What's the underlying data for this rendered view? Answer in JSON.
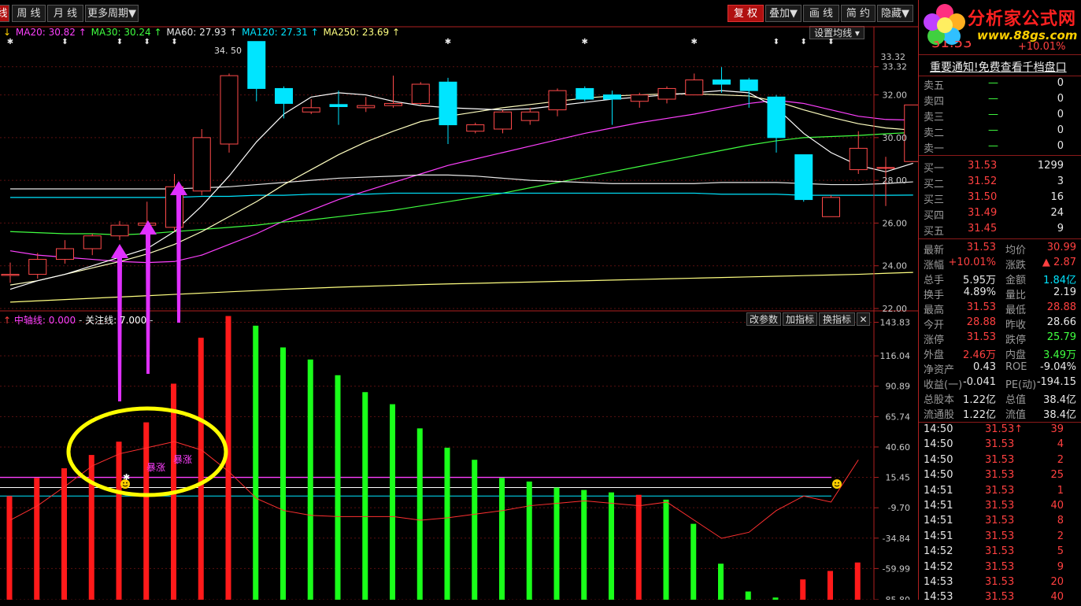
{
  "toolbar": {
    "left_partial": "线",
    "tabs": [
      {
        "label": "周 线"
      },
      {
        "label": "月 线"
      },
      {
        "label": "更多周期▼"
      }
    ],
    "right_buttons": [
      {
        "label": "复 权",
        "active": true
      },
      {
        "label": "叠加▼",
        "active": false
      },
      {
        "label": "画 线",
        "active": false
      },
      {
        "label": "简 约",
        "active": false
      },
      {
        "label": "隐藏▼",
        "active": false
      }
    ]
  },
  "main_legend": [
    {
      "text": "↓",
      "color": "#ffd000"
    },
    {
      "text": "MA20: 30.82 ↑",
      "color": "#ff40ff"
    },
    {
      "text": "MA30: 30.24 ↑",
      "color": "#40ff40"
    },
    {
      "text": "MA60: 27.93 ↑",
      "color": "#e8e8e8"
    },
    {
      "text": "MA120: 27.31 ↑",
      "color": "#00e5ff"
    },
    {
      "text": "MA250: 23.69 ↑",
      "color": "#ffff80"
    }
  ],
  "ma_settings_label": "设置均线",
  "ind_legend": {
    "arrow": "↑",
    "zhong": "中轴线: 0.000",
    "dash": "-",
    "guanzhu": "关注线: 7.000",
    "trail": "-"
  },
  "ind_buttons": [
    "改参数",
    "加指标",
    "换指标",
    "✕"
  ],
  "ad": {
    "brand": "分析家公式网",
    "url": "www.88gs.com",
    "stock_price": "31.53",
    "stock_pct": "+10.01%"
  },
  "notice": "重要通知!免费查看千档盘口",
  "orderbook": {
    "sells": [
      {
        "label": "卖五",
        "price": "—",
        "vol": "0"
      },
      {
        "label": "卖四",
        "price": "—",
        "vol": "0"
      },
      {
        "label": "卖三",
        "price": "—",
        "vol": "0"
      },
      {
        "label": "卖二",
        "price": "—",
        "vol": "0"
      },
      {
        "label": "卖一",
        "price": "—",
        "vol": "0"
      }
    ],
    "buys": [
      {
        "label": "买一",
        "price": "31.53",
        "vol": "1299"
      },
      {
        "label": "买二",
        "price": "31.52",
        "vol": "3"
      },
      {
        "label": "买三",
        "price": "31.50",
        "vol": "16"
      },
      {
        "label": "买四",
        "price": "31.49",
        "vol": "24"
      },
      {
        "label": "买五",
        "price": "31.45",
        "vol": "9"
      }
    ]
  },
  "stats": [
    [
      {
        "l": "最新",
        "v": "31.53",
        "c": "red"
      },
      {
        "l": "均价",
        "v": "30.99",
        "c": "red"
      }
    ],
    [
      {
        "l": "涨幅",
        "v": "+10.01%",
        "c": "red"
      },
      {
        "l": "涨跌",
        "v": "▲ 2.87",
        "c": "red"
      }
    ],
    [
      {
        "l": "总手",
        "v": "5.95万",
        "c": "white"
      },
      {
        "l": "金额",
        "v": "1.84亿",
        "c": "cyan"
      }
    ],
    [
      {
        "l": "换手",
        "v": "4.89%",
        "c": "white"
      },
      {
        "l": "量比",
        "v": "2.19",
        "c": "white"
      }
    ],
    [
      {
        "l": "最高",
        "v": "31.53",
        "c": "red"
      },
      {
        "l": "最低",
        "v": "28.88",
        "c": "red"
      }
    ],
    [
      {
        "l": "今开",
        "v": "28.88",
        "c": "red"
      },
      {
        "l": "昨收",
        "v": "28.66",
        "c": "white"
      }
    ],
    [
      {
        "l": "涨停",
        "v": "31.53",
        "c": "red"
      },
      {
        "l": "跌停",
        "v": "25.79",
        "c": "green"
      }
    ],
    [
      {
        "l": "外盘",
        "v": "2.46万",
        "c": "red"
      },
      {
        "l": "内盘",
        "v": "3.49万",
        "c": "green"
      }
    ],
    [
      {
        "l": "净资产",
        "v": "0.43",
        "c": "white"
      },
      {
        "l": "ROE",
        "v": "-9.04%",
        "c": "white"
      }
    ],
    [
      {
        "l": "收益(一)",
        "v": "-0.041",
        "c": "white"
      },
      {
        "l": "PE(动)",
        "v": "-194.15",
        "c": "white"
      }
    ],
    [
      {
        "l": "总股本",
        "v": "1.22亿",
        "c": "white"
      },
      {
        "l": "总值",
        "v": "38.4亿",
        "c": "white"
      }
    ],
    [
      {
        "l": "流通股",
        "v": "1.22亿",
        "c": "white"
      },
      {
        "l": "流值",
        "v": "38.4亿",
        "c": "white"
      }
    ]
  ],
  "ticks": [
    {
      "t": "14:50",
      "p": "31.53↑",
      "v": "39"
    },
    {
      "t": "14:50",
      "p": "31.53",
      "v": "4"
    },
    {
      "t": "14:50",
      "p": "31.53",
      "v": "2"
    },
    {
      "t": "14:50",
      "p": "31.53",
      "v": "25"
    },
    {
      "t": "14:51",
      "p": "31.53",
      "v": "1"
    },
    {
      "t": "14:51",
      "p": "31.53",
      "v": "40"
    },
    {
      "t": "14:51",
      "p": "31.53",
      "v": "8"
    },
    {
      "t": "14:51",
      "p": "31.53",
      "v": "2"
    },
    {
      "t": "14:52",
      "p": "31.53",
      "v": "5"
    },
    {
      "t": "14:52",
      "p": "31.53",
      "v": "9"
    },
    {
      "t": "14:53",
      "p": "31.53",
      "v": "20"
    },
    {
      "t": "14:53",
      "p": "31.53",
      "v": "40"
    }
  ],
  "annotations": {
    "burst1": "暴涨",
    "burst2": "暴涨",
    "peak_label": "34. 50"
  },
  "chart_data": [
    {
      "type": "candlestick",
      "yticks": [
        "33.32",
        "32.00",
        "30.00",
        "28.00",
        "26.00",
        "24.00",
        "22.00"
      ],
      "ylim": [
        22.0,
        34.6
      ],
      "candles": [
        {
          "o": 23.55,
          "h": 24.15,
          "l": 23.2,
          "c": 23.6
        },
        {
          "o": 23.6,
          "h": 24.6,
          "l": 23.4,
          "c": 24.3
        },
        {
          "o": 24.3,
          "h": 25.2,
          "l": 24.1,
          "c": 24.8
        },
        {
          "o": 24.8,
          "h": 25.5,
          "l": 24.5,
          "c": 25.4
        },
        {
          "o": 25.4,
          "h": 26.1,
          "l": 25.2,
          "c": 25.9
        },
        {
          "o": 25.9,
          "h": 27.0,
          "l": 25.7,
          "c": 26.0
        },
        {
          "o": 25.8,
          "h": 28.3,
          "l": 25.6,
          "c": 27.7
        },
        {
          "o": 27.5,
          "h": 30.4,
          "l": 27.3,
          "c": 30.0
        },
        {
          "o": 29.7,
          "h": 33.0,
          "l": 29.3,
          "c": 32.9
        },
        {
          "o": 34.5,
          "h": 34.5,
          "l": 31.7,
          "c": 32.3
        },
        {
          "o": 32.3,
          "h": 32.4,
          "l": 30.9,
          "c": 31.6
        },
        {
          "o": 31.2,
          "h": 31.8,
          "l": 31.1,
          "c": 31.4
        },
        {
          "o": 31.55,
          "h": 32.2,
          "l": 30.6,
          "c": 31.45
        },
        {
          "o": 31.4,
          "h": 31.9,
          "l": 31.2,
          "c": 31.5
        },
        {
          "o": 31.5,
          "h": 32.9,
          "l": 31.4,
          "c": 31.6
        },
        {
          "o": 31.6,
          "h": 32.6,
          "l": 31.5,
          "c": 32.5
        },
        {
          "o": 32.6,
          "h": 32.8,
          "l": 29.7,
          "c": 30.6
        },
        {
          "o": 30.3,
          "h": 30.7,
          "l": 30.2,
          "c": 30.6
        },
        {
          "o": 30.4,
          "h": 31.3,
          "l": 30.2,
          "c": 31.2
        },
        {
          "o": 30.8,
          "h": 31.4,
          "l": 30.6,
          "c": 31.2
        },
        {
          "o": 31.3,
          "h": 32.3,
          "l": 31.0,
          "c": 32.2
        },
        {
          "o": 32.3,
          "h": 32.4,
          "l": 31.7,
          "c": 31.8
        },
        {
          "o": 32.0,
          "h": 32.2,
          "l": 30.6,
          "c": 31.8
        },
        {
          "o": 31.7,
          "h": 32.1,
          "l": 31.4,
          "c": 32.0
        },
        {
          "o": 31.8,
          "h": 32.4,
          "l": 31.6,
          "c": 32.3
        },
        {
          "o": 32.0,
          "h": 33.0,
          "l": 32.0,
          "c": 32.7
        },
        {
          "o": 32.7,
          "h": 33.3,
          "l": 32.1,
          "c": 32.5
        },
        {
          "o": 32.7,
          "h": 32.8,
          "l": 31.4,
          "c": 32.2
        },
        {
          "o": 31.9,
          "h": 32.0,
          "l": 29.3,
          "c": 30.0
        },
        {
          "o": 29.2,
          "h": 29.2,
          "l": 27.0,
          "c": 27.1
        },
        {
          "o": 26.3,
          "h": 27.3,
          "l": 26.3,
          "c": 27.2
        },
        {
          "o": 28.5,
          "h": 30.3,
          "l": 28.3,
          "c": 29.5
        },
        {
          "o": 28.6,
          "h": 29.1,
          "l": 26.8,
          "c": 28.6
        },
        {
          "o": 28.88,
          "h": 31.53,
          "l": 28.88,
          "c": 31.53
        }
      ],
      "ma": [
        {
          "name": "MA20",
          "color": "#ff40ff",
          "values": [
            24.7,
            24.5,
            24.4,
            24.3,
            24.2,
            24.15,
            24.2,
            24.5,
            25.0,
            25.5,
            26.1,
            26.6,
            27.1,
            27.5,
            27.9,
            28.3,
            28.7,
            29.0,
            29.3,
            29.6,
            29.9,
            30.2,
            30.45,
            30.7,
            30.9,
            31.1,
            31.35,
            31.6,
            31.75,
            31.6,
            31.3,
            31.0,
            30.85,
            30.82
          ]
        },
        {
          "name": "MA30",
          "color": "#40ff40",
          "values": [
            25.6,
            25.55,
            25.5,
            25.5,
            25.45,
            25.5,
            25.6,
            25.7,
            25.8,
            25.9,
            26.05,
            26.15,
            26.3,
            26.45,
            26.6,
            26.8,
            27.0,
            27.2,
            27.4,
            27.65,
            27.9,
            28.15,
            28.4,
            28.65,
            28.9,
            29.15,
            29.4,
            29.65,
            29.85,
            30.0,
            30.05,
            30.1,
            30.18,
            30.24
          ]
        },
        {
          "name": "MA60",
          "color": "#e8e8e8",
          "values": [
            27.6,
            27.6,
            27.6,
            27.6,
            27.6,
            27.6,
            27.6,
            27.65,
            27.7,
            27.8,
            27.9,
            28.0,
            28.1,
            28.15,
            28.2,
            28.25,
            28.25,
            28.2,
            28.1,
            28.0,
            27.95,
            27.9,
            27.85,
            27.85,
            27.85,
            27.85,
            27.9,
            27.9,
            27.9,
            27.85,
            27.8,
            27.8,
            27.85,
            27.93
          ]
        },
        {
          "name": "MA120",
          "color": "#00e5ff",
          "values": [
            27.2,
            27.2,
            27.2,
            27.2,
            27.2,
            27.2,
            27.2,
            27.25,
            27.25,
            27.3,
            27.3,
            27.35,
            27.35,
            27.35,
            27.4,
            27.4,
            27.4,
            27.4,
            27.4,
            27.4,
            27.4,
            27.4,
            27.4,
            27.4,
            27.4,
            27.4,
            27.35,
            27.35,
            27.35,
            27.3,
            27.3,
            27.3,
            27.3,
            27.31
          ]
        },
        {
          "name": "MA250",
          "color": "#ffff80",
          "values": [
            22.3,
            22.36,
            22.42,
            22.48,
            22.54,
            22.6,
            22.66,
            22.72,
            22.78,
            22.84,
            22.9,
            22.95,
            23.0,
            23.04,
            23.08,
            23.12,
            23.15,
            23.18,
            23.21,
            23.24,
            23.27,
            23.3,
            23.33,
            23.36,
            23.39,
            23.42,
            23.45,
            23.48,
            23.51,
            23.54,
            23.57,
            23.6,
            23.65,
            23.69
          ]
        },
        {
          "name": "",
          "color": "#ffffc0",
          "values": [
            23.1,
            23.3,
            23.6,
            23.9,
            24.2,
            24.55,
            25.0,
            25.6,
            26.3,
            27.0,
            27.8,
            28.5,
            29.2,
            29.8,
            30.3,
            30.75,
            31.0,
            31.2,
            31.4,
            31.55,
            31.7,
            31.85,
            31.95,
            32.0,
            32.05,
            32.05,
            32.0,
            31.95,
            31.7,
            31.3,
            30.95,
            30.65,
            30.45,
            30.35
          ]
        },
        {
          "name": "",
          "color": "#ffffff",
          "values": [
            22.9,
            23.3,
            23.6,
            24.0,
            24.4,
            24.8,
            25.6,
            26.8,
            28.2,
            29.8,
            31.1,
            31.9,
            32.1,
            32.0,
            31.7,
            31.5,
            31.4,
            31.35,
            31.3,
            31.35,
            31.5,
            31.65,
            31.8,
            31.9,
            32.0,
            32.1,
            32.2,
            32.1,
            31.4,
            30.2,
            29.3,
            28.7,
            28.4,
            28.8
          ]
        }
      ]
    },
    {
      "type": "bar",
      "title": "中轴线 / 关注线",
      "yticks": [
        "143.83",
        "116.04",
        "90.89",
        "65.74",
        "40.60",
        "15.45",
        "-9.70",
        "-34.84",
        "-59.99",
        "-85.80"
      ],
      "ylim": [
        -85.8,
        150
      ],
      "baseline": -85.8,
      "values": [
        0,
        15,
        23,
        34,
        45,
        61,
        93,
        131,
        149,
        141,
        123,
        113,
        100,
        86,
        76,
        56,
        40,
        30,
        15,
        12,
        7,
        5,
        3,
        1,
        -3,
        -23,
        -56,
        -79,
        -84,
        -69,
        -62,
        -55
      ],
      "colors": [
        "r",
        "r",
        "r",
        "r",
        "r",
        "r",
        "r",
        "r",
        "r",
        "g",
        "g",
        "g",
        "g",
        "g",
        "g",
        "g",
        "g",
        "g",
        "g",
        "g",
        "g",
        "g",
        "g",
        "r",
        "g",
        "g",
        "g",
        "g",
        "g",
        "r",
        "r",
        "r"
      ],
      "signal": [
        -20,
        -8,
        8,
        25,
        35,
        40,
        45,
        38,
        20,
        -2,
        -12,
        -16,
        -17,
        -17,
        -17,
        -20,
        -18,
        -15,
        -12,
        -8,
        -6,
        -4,
        -6,
        -8,
        -5,
        -20,
        -35,
        -30,
        -12,
        0,
        -5,
        30
      ],
      "purple_line": 15.45,
      "white_line": 7.0,
      "cyan_line": 0.0
    }
  ]
}
